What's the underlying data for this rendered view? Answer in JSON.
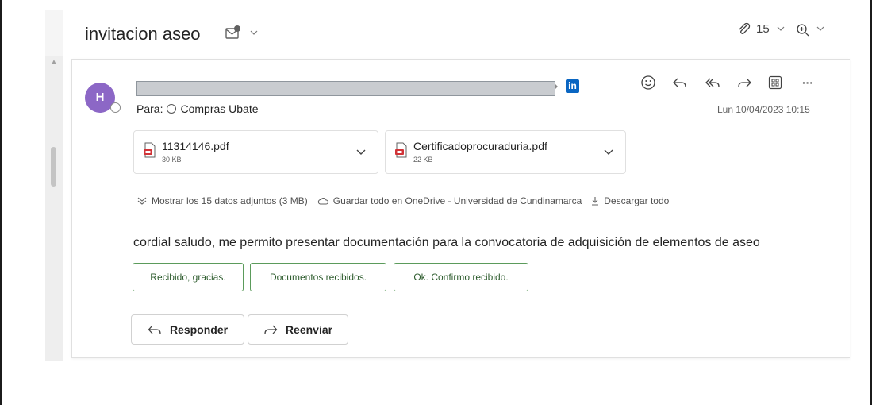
{
  "header": {
    "subject": "invitacion aseo",
    "attachment_count": "15",
    "icons": [
      "message-tag-icon",
      "paperclip-icon",
      "zoom-icon"
    ]
  },
  "message": {
    "avatar_initial": "H",
    "recipient_label": "Para:",
    "recipient": "Compras Ubate",
    "date": "Lun 10/04/2023 10:15",
    "linkedin_badge": "in",
    "actions": [
      "emoji-icon",
      "reply-icon",
      "reply-all-icon",
      "forward-icon",
      "apps-icon",
      "more-icon"
    ],
    "more_label": "···",
    "attachments": [
      {
        "name": "11314146.pdf",
        "size": "30 KB"
      },
      {
        "name": "Certificadoprocuraduria.pdf",
        "size": "22 KB"
      }
    ],
    "attachment_tools": {
      "show_all": "Mostrar los 15 datos adjuntos (3 MB)",
      "save_onedrive": "Guardar todo en OneDrive - Universidad de Cundinamarca",
      "download_all": "Descargar todo"
    },
    "body": "cordial saludo, me permito presentar documentación para la convocatoria de adquisición de elementos de aseo",
    "suggested_replies": [
      "Recibido, gracias.",
      "Documentos recibidos.",
      "Ok. Confirmo recibido."
    ],
    "reply_button": "Responder",
    "forward_button": "Reenviar"
  },
  "colors": {
    "avatar": "#8c67c6",
    "linkedin": "#0a66c2",
    "suggestion_border": "#5b9b5b",
    "pdf_red": "#d13438"
  }
}
